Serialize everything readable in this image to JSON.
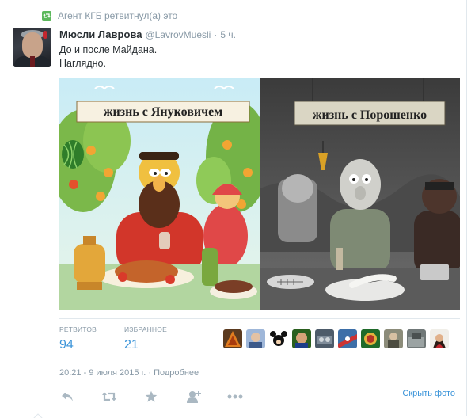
{
  "retweet_context": {
    "icon": "retweet-icon",
    "text": "Агент КГБ ретвитнул(а) это",
    "accent": "#5cb85c"
  },
  "tweet": {
    "fullname": "Мюсли Лаврова",
    "username": "@LavrovMuesli",
    "separator": "·",
    "time": "5 ч.",
    "text_lines": [
      "До и после Майдана.",
      "Наглядно."
    ],
    "image": {
      "left_banner": "жизнь с Януковичем",
      "right_banner": "жизнь с Порошенко"
    }
  },
  "stats": {
    "retweets_label": "РЕТВИТОВ",
    "retweets_value": "94",
    "favorites_label": "ИЗБРАННОЕ",
    "favorites_value": "21",
    "favoriter_avatars": [
      "avatar-1",
      "avatar-2",
      "avatar-3",
      "avatar-4",
      "avatar-5",
      "avatar-6",
      "avatar-7",
      "avatar-8",
      "avatar-9",
      "avatar-10"
    ]
  },
  "meta": {
    "timestamp": "20:21 - 9 июля 2015 г.",
    "separator": "·",
    "details_link": "Подробнее"
  },
  "actions": {
    "reply_icon": "reply-icon",
    "retweet_icon": "retweet-icon",
    "favorite_icon": "star-icon",
    "follow_icon": "add-user-icon",
    "more_icon": "more-icon",
    "hide_photo": "Скрыть фото"
  },
  "colors": {
    "link_blue": "#3b94d9",
    "muted": "#8899a6",
    "text": "#292f33",
    "icon_grey": "#aab8c2"
  }
}
